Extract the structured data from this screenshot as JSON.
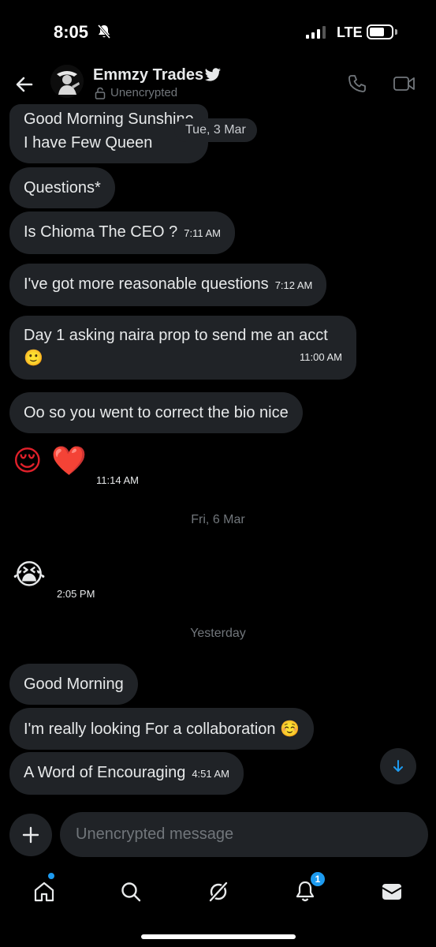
{
  "status_bar": {
    "time": "8:05",
    "network": "LTE"
  },
  "header": {
    "contact_name": "Emmzy Trades",
    "encryption_label": "Unencrypted"
  },
  "messages": [
    {
      "text_line1": "Good Morning Sunshine",
      "text_line2": "I have Few Queen"
    },
    {
      "text": "Questions*"
    },
    {
      "text": "Is Chioma The CEO ?",
      "time": "7:11 AM"
    },
    {
      "text": "I've got more reasonable questions",
      "time": "7:12 AM"
    },
    {
      "text": "Day 1 asking naira prop to send me an acct",
      "emoji": "🙂",
      "time": "11:00 AM"
    },
    {
      "text": "Oo so you went to correct the bio nice"
    },
    {
      "emoji": "😌 ❤️",
      "time": "11:14 AM"
    },
    {
      "emoji": "😭",
      "time": "2:05 PM"
    },
    {
      "text": "Good Morning"
    },
    {
      "text": "I'm really looking For a collaboration",
      "emoji": "☺️"
    },
    {
      "text": "A Word of Encouraging",
      "time": "4:51 AM"
    }
  ],
  "date_separators": {
    "floating": "Tue, 3 Mar",
    "fri": "Fri, 6 Mar",
    "yesterday": "Yesterday"
  },
  "composer": {
    "placeholder": "Unencrypted message"
  },
  "bottom_nav": {
    "notifications_badge": "1",
    "items": [
      "home-icon",
      "search-icon",
      "grok-icon",
      "bell-icon",
      "messages-icon"
    ]
  },
  "colors": {
    "accent": "#1d9bf0",
    "bubble": "#202327",
    "muted": "#71767b"
  }
}
